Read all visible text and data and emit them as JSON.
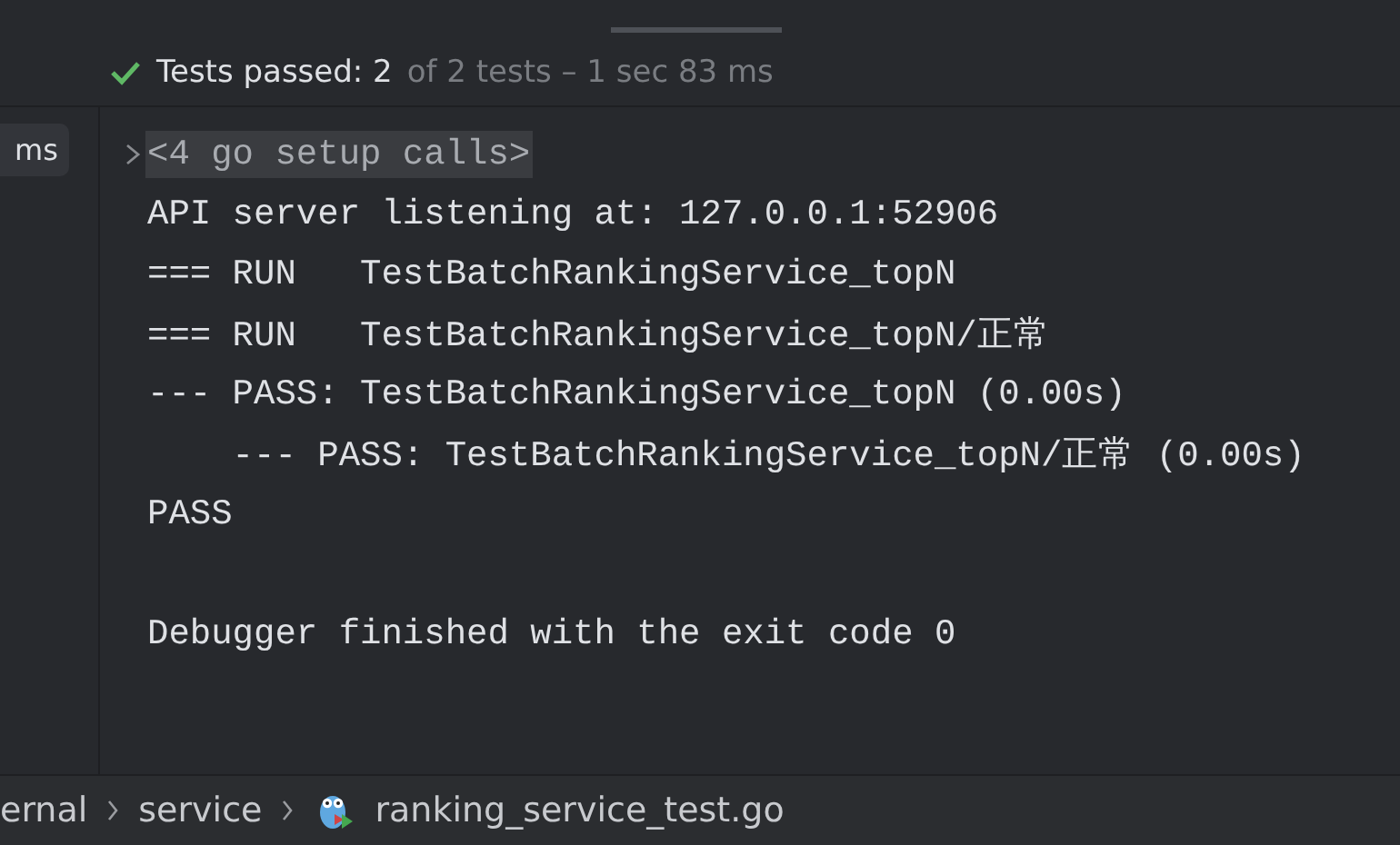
{
  "status": {
    "passed": "Tests passed: 2",
    "detail": "of 2 tests – 1 sec 83 ms"
  },
  "sidebar": {
    "duration": "ms"
  },
  "console": [
    {
      "kind": "folded",
      "text": "<4 go setup calls>"
    },
    {
      "kind": "plain",
      "text": "API server listening at: 127.0.0.1:52906"
    },
    {
      "kind": "plain",
      "text": "=== RUN   TestBatchRankingService_topN"
    },
    {
      "kind": "plain",
      "text": "=== RUN   TestBatchRankingService_topN/正常"
    },
    {
      "kind": "plain",
      "text": "--- PASS: TestBatchRankingService_topN (0.00s)"
    },
    {
      "kind": "plain",
      "text": "    --- PASS: TestBatchRankingService_topN/正常 (0.00s)"
    },
    {
      "kind": "plain",
      "text": "PASS"
    },
    {
      "kind": "blank"
    },
    {
      "kind": "plain",
      "text": "Debugger finished with the exit code 0"
    }
  ],
  "breadcrumbs": [
    {
      "label": "ernal",
      "kind": "folder"
    },
    {
      "label": "service",
      "kind": "folder"
    },
    {
      "label": "ranking_service_test.go",
      "kind": "gofile"
    }
  ]
}
